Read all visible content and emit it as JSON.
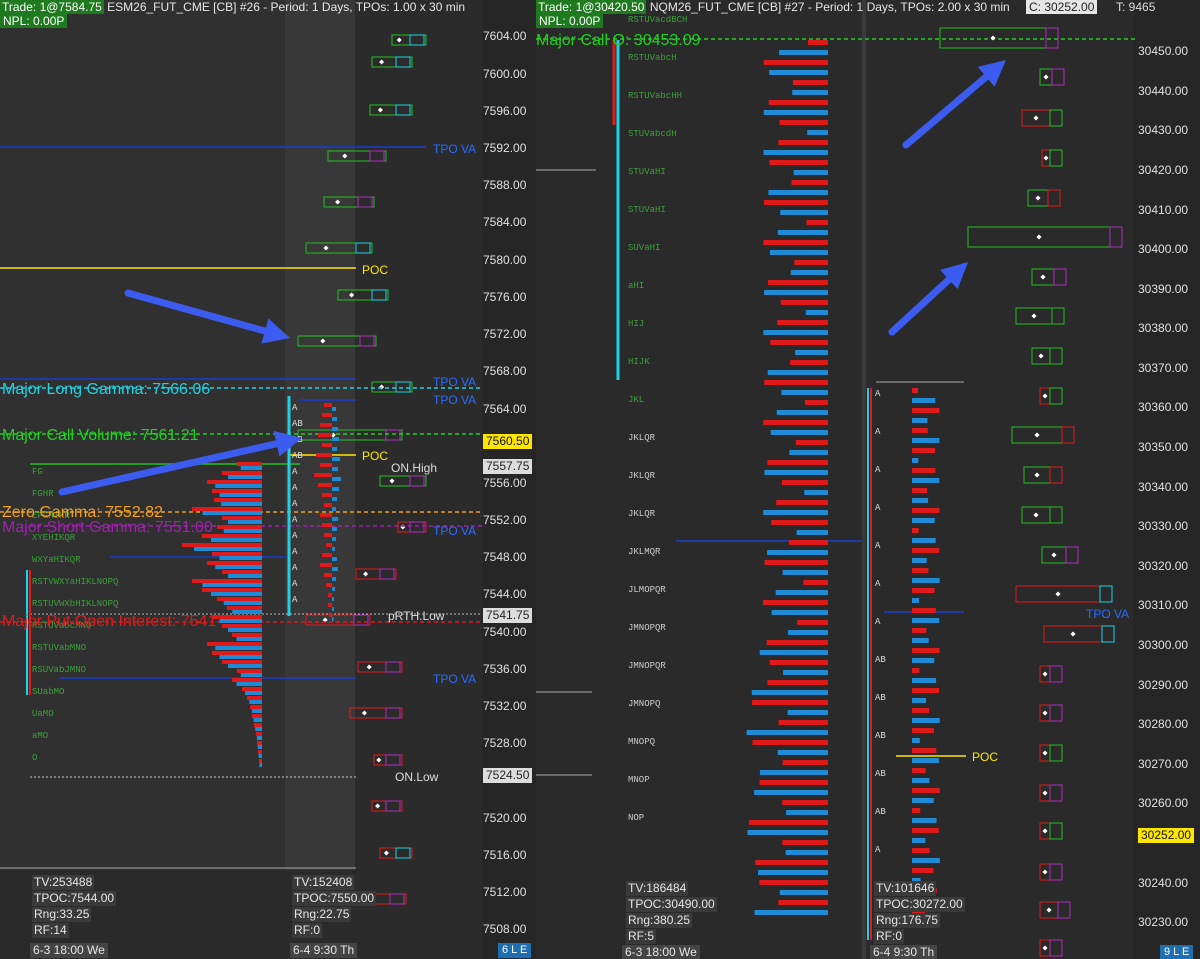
{
  "left": {
    "trade": "Trade: 1@7584.75",
    "title": "ESM26_FUT_CME [CB] #26 - Period: 1 Days, TPOs: 1.00 x 30 min",
    "npl": "NPL: 0.00P",
    "prices": [
      "7604.00",
      "7600.00",
      "7596.00",
      "7592.00",
      "7588.00",
      "7584.00",
      "7580.00",
      "7576.00",
      "7572.00",
      "7568.00",
      "7564.00",
      "7560.50",
      "7557.75",
      "7556.00",
      "7552.00",
      "7548.00",
      "7544.00",
      "7541.75",
      "7540.00",
      "7536.00",
      "7532.00",
      "7528.00",
      "7524.50",
      "7520.00",
      "7516.00",
      "7512.00",
      "7508.00"
    ],
    "current_price": "7560.50",
    "onhigh_price": "7557.75",
    "prth_price": "7541.75",
    "onlow_price": "7524.50",
    "labels": {
      "tpo_va_1": "TPO VA",
      "poc_1": "POC",
      "tpo_va_2": "TPO VA",
      "tpo_va_3": "TPO VA",
      "major_long_gamma": "Major Long Gamma: 7566.06",
      "major_call_volume": "Major Call Volume: 7561.21",
      "poc_2": "POC",
      "on_high": "ON.High",
      "zero_gamma": "Zero Gamma: 7552.82",
      "major_short_gamma": "Major Short Gamma: 7551.00",
      "tpo_va_4": "TPO VA",
      "prth_low": "pRTH.Low",
      "major_put_oi": "Major Put Open Interest: 7541",
      "tpo_va_5": "TPO VA",
      "on_low": "ON.Low"
    },
    "stats_1": {
      "tv": "TV:253488",
      "tpoc": "TPOC:7544.00",
      "rng": "Rng:33.25",
      "rf": "RF:14"
    },
    "stats_2": {
      "tv": "TV:152408",
      "tpoc": "TPOC:7550.00",
      "rng": "Rng:22.75",
      "rf": "RF:0"
    },
    "date_1": "6-3   18:00 We",
    "date_2": "6-4   9:30 Th",
    "corner": "6 L E"
  },
  "right": {
    "trade": "Trade: 1@30420.50",
    "title": "NQM26_FUT_CME [CB] #27 - Period: 1 Days, TPOs: 2.00 x 30 min",
    "close": "C: 30252.00",
    "t": "T: 9465",
    "npl": "NPL: 0.00P",
    "prices": [
      "30450.00",
      "30440.00",
      "30430.00",
      "30420.00",
      "30410.00",
      "30400.00",
      "30390.00",
      "30380.00",
      "30370.00",
      "30360.00",
      "30350.00",
      "30340.00",
      "30330.00",
      "30320.00",
      "30310.00",
      "30300.00",
      "30290.00",
      "30280.00",
      "30270.00",
      "30260.00",
      "30252.00",
      "30240.00",
      "30230.00"
    ],
    "current_price": "30252.00",
    "labels": {
      "major_call_oi": "Major Call O: 30453.09",
      "tpo_va": "TPO VA",
      "poc": "POC"
    },
    "stats_1": {
      "tv": "TV:186484",
      "tpoc": "TPOC:30490.00",
      "rng": "Rng:380.25",
      "rf": "RF:5"
    },
    "stats_2": {
      "tv": "TV:101646",
      "tpoc": "TPOC:30272.00",
      "rng": "Rng:176.75",
      "rf": "RF:0"
    },
    "date_1": "6-3   18:00 We",
    "date_2": "6-4   9:30 Th",
    "corner": "9 L E"
  },
  "colors": {
    "green": "#22c022",
    "red": "#e01a1a",
    "blue": "#1a6fd6",
    "yellow": "#ffe600",
    "cyan": "#1ed2e6",
    "purple": "#b02cc0",
    "orange": "#f0a020",
    "arrow": "#3c5cf0"
  }
}
